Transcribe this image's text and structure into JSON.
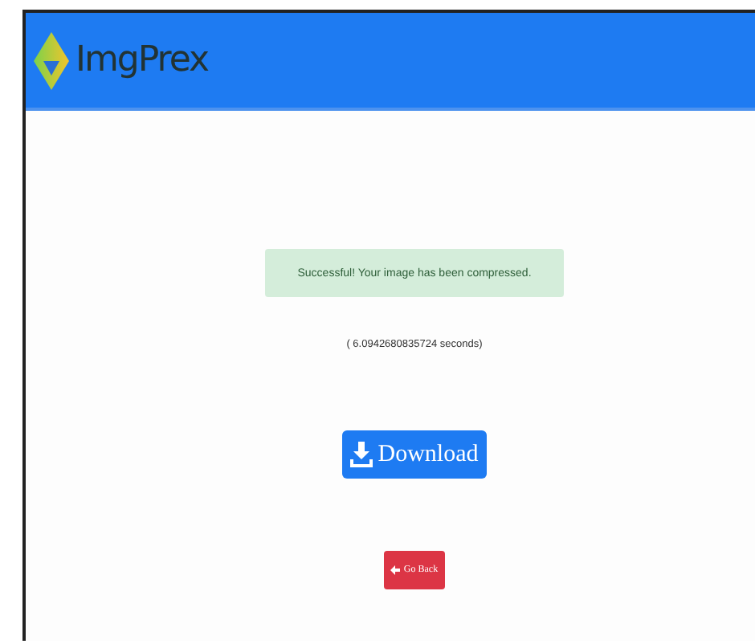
{
  "header": {
    "brand": "ImgPrex"
  },
  "alert": {
    "message": "Successful! Your image has been compressed."
  },
  "timing": "( 6.0942680835724 seconds)",
  "buttons": [
    {
      "kind": "download",
      "label": "Download"
    },
    {
      "kind": "back",
      "label": "Go Back"
    }
  ]
}
